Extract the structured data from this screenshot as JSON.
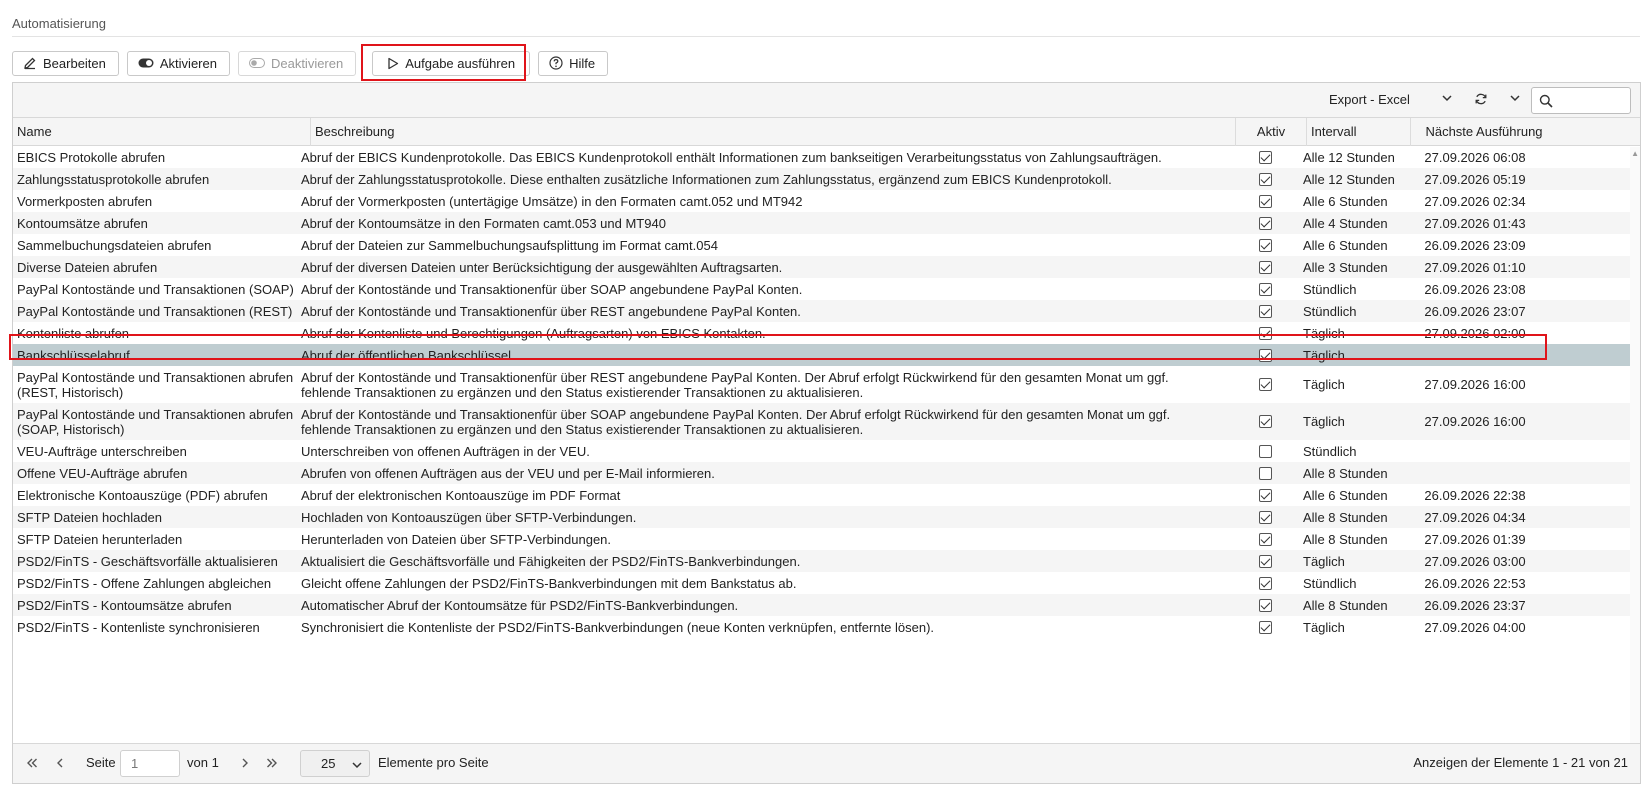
{
  "page": {
    "title": "Automatisierung"
  },
  "toolbar": {
    "edit_label": "Bearbeiten",
    "activate_label": "Aktivieren",
    "deactivate_label": "Deaktivieren",
    "run_label": "Aufgabe ausführen",
    "help_label": "Hilfe"
  },
  "grid_toolbar": {
    "export_label": "Export - Excel",
    "search_placeholder": ""
  },
  "columns": {
    "name": "Name",
    "description": "Beschreibung",
    "active": "Aktiv",
    "interval": "Intervall",
    "next_run": "Nächste Ausführung"
  },
  "rows": [
    {
      "name": "EBICS Protokolle abrufen",
      "description": "Abruf der EBICS Kundenprotokolle. Das EBICS Kundenprotokoll enthält Informationen zum bankseitigen Verarbeitungsstatus von Zahlungsaufträgen.",
      "active": true,
      "interval": "Alle 12 Stunden",
      "next_run": "27.09.2026 06:08"
    },
    {
      "name": "Zahlungsstatusprotokolle abrufen",
      "description": "Abruf der Zahlungsstatusprotokolle. Diese enthalten zusätzliche Informationen zum Zahlungsstatus, ergänzend zum EBICS Kundenprotokoll.",
      "active": true,
      "interval": "Alle 12 Stunden",
      "next_run": "27.09.2026 05:19"
    },
    {
      "name": "Vormerkposten abrufen",
      "description": "Abruf der Vormerkposten (untertägige Umsätze) in den Formaten camt.052 und MT942",
      "active": true,
      "interval": "Alle 6 Stunden",
      "next_run": "27.09.2026 02:34"
    },
    {
      "name": "Kontoumsätze abrufen",
      "description": "Abruf der Kontoumsätze in den Formaten camt.053 und MT940",
      "active": true,
      "interval": "Alle 4 Stunden",
      "next_run": "27.09.2026 01:43"
    },
    {
      "name": "Sammelbuchungsdateien abrufen",
      "description": "Abruf der Dateien zur Sammelbuchungsaufsplittung im Format camt.054",
      "active": true,
      "interval": "Alle 6 Stunden",
      "next_run": "26.09.2026 23:09"
    },
    {
      "name": "Diverse Dateien abrufen",
      "description": "Abruf der diversen Dateien unter Berücksichtigung der ausgewählten Auftragsarten.",
      "active": true,
      "interval": "Alle 3 Stunden",
      "next_run": "27.09.2026 01:10"
    },
    {
      "name": "PayPal Kontostände und Transaktionen (SOAP)",
      "description": "Abruf der Kontostände und Transaktionenfür über SOAP angebundene PayPal Konten.",
      "active": true,
      "interval": "Stündlich",
      "next_run": "26.09.2026 23:08"
    },
    {
      "name": "PayPal Kontostände und Transaktionen (REST)",
      "description": "Abruf der Kontostände und Transaktionenfür über REST angebundene PayPal Konten.",
      "active": true,
      "interval": "Stündlich",
      "next_run": "26.09.2026 23:07"
    },
    {
      "name": "Kontenliste abrufen",
      "description": "Abruf der Kontenliste und Berechtigungen (Auftragsarten) von EBICS Kontakten.",
      "active": true,
      "interval": "Täglich",
      "next_run": "27.09.2026 02:00"
    },
    {
      "name": "Bankschlüsselabruf",
      "description": "Abruf der öffentlichen Bankschlüssel.",
      "active": true,
      "interval": "Täglich",
      "next_run": "",
      "selected": true
    },
    {
      "name": "PayPal Kontostände und Transaktionen abrufen (REST, Historisch)",
      "description": "Abruf der Kontostände und Transaktionenfür über REST angebundene PayPal Konten. Der Abruf erfolgt Rückwirkend für den gesamten Monat um ggf. fehlende Transaktionen zu ergänzen und den Status existierender Transaktionen zu aktualisieren.",
      "active": true,
      "interval": "Täglich",
      "next_run": "27.09.2026 16:00",
      "tall": true
    },
    {
      "name": "PayPal Kontostände und Transaktionen abrufen (SOAP, Historisch)",
      "description": "Abruf der Kontostände und Transaktionenfür über SOAP angebundene PayPal Konten. Der Abruf erfolgt Rückwirkend für den gesamten Monat um ggf. fehlende Transaktionen zu ergänzen und den Status existierender Transaktionen zu aktualisieren.",
      "active": true,
      "interval": "Täglich",
      "next_run": "27.09.2026 16:00",
      "tall": true
    },
    {
      "name": "VEU-Aufträge unterschreiben",
      "description": "Unterschreiben von offenen Aufträgen in der VEU.",
      "active": false,
      "interval": "Stündlich",
      "next_run": ""
    },
    {
      "name": "Offene VEU-Aufträge abrufen",
      "description": "Abrufen von offenen Aufträgen aus der VEU und per E-Mail informieren.",
      "active": false,
      "interval": "Alle 8 Stunden",
      "next_run": ""
    },
    {
      "name": "Elektronische Kontoauszüge (PDF) abrufen",
      "description": "Abruf der elektronischen Kontoauszüge im PDF Format",
      "active": true,
      "interval": "Alle 6 Stunden",
      "next_run": "26.09.2026 22:38"
    },
    {
      "name": "SFTP Dateien hochladen",
      "description": "Hochladen von Kontoauszügen über SFTP-Verbindungen.",
      "active": true,
      "interval": "Alle 8 Stunden",
      "next_run": "27.09.2026 04:34"
    },
    {
      "name": "SFTP Dateien herunterladen",
      "description": "Herunterladen von Dateien über SFTP-Verbindungen.",
      "active": true,
      "interval": "Alle 8 Stunden",
      "next_run": "27.09.2026 01:39"
    },
    {
      "name": "PSD2/FinTS - Geschäftsvorfälle aktualisieren",
      "description": "Aktualisiert die Geschäftsvorfälle und Fähigkeiten der PSD2/FinTS-Bankverbindungen.",
      "active": true,
      "interval": "Täglich",
      "next_run": "27.09.2026 03:00"
    },
    {
      "name": "PSD2/FinTS - Offene Zahlungen abgleichen",
      "description": "Gleicht offene Zahlungen der PSD2/FinTS-Bankverbindungen mit dem Bankstatus ab.",
      "active": true,
      "interval": "Stündlich",
      "next_run": "26.09.2026 22:53"
    },
    {
      "name": "PSD2/FinTS - Kontoumsätze abrufen",
      "description": "Automatischer Abruf der Kontoumsätze für PSD2/FinTS-Bankverbindungen.",
      "active": true,
      "interval": "Alle 8 Stunden",
      "next_run": "26.09.2026 23:37"
    },
    {
      "name": "PSD2/FinTS - Kontenliste synchronisieren",
      "description": "Synchronisiert die Kontenliste der PSD2/FinTS-Bankverbindungen (neue Konten verknüpfen, entfernte lösen).",
      "active": true,
      "interval": "Täglich",
      "next_run": "27.09.2026 04:00"
    }
  ],
  "pager": {
    "page_label": "Seite",
    "page_value": "1",
    "of_label": "von 1",
    "page_size": "25",
    "per_page_label": "Elemente pro Seite",
    "summary": "Anzeigen der Elemente 1 - 21 von 21"
  }
}
